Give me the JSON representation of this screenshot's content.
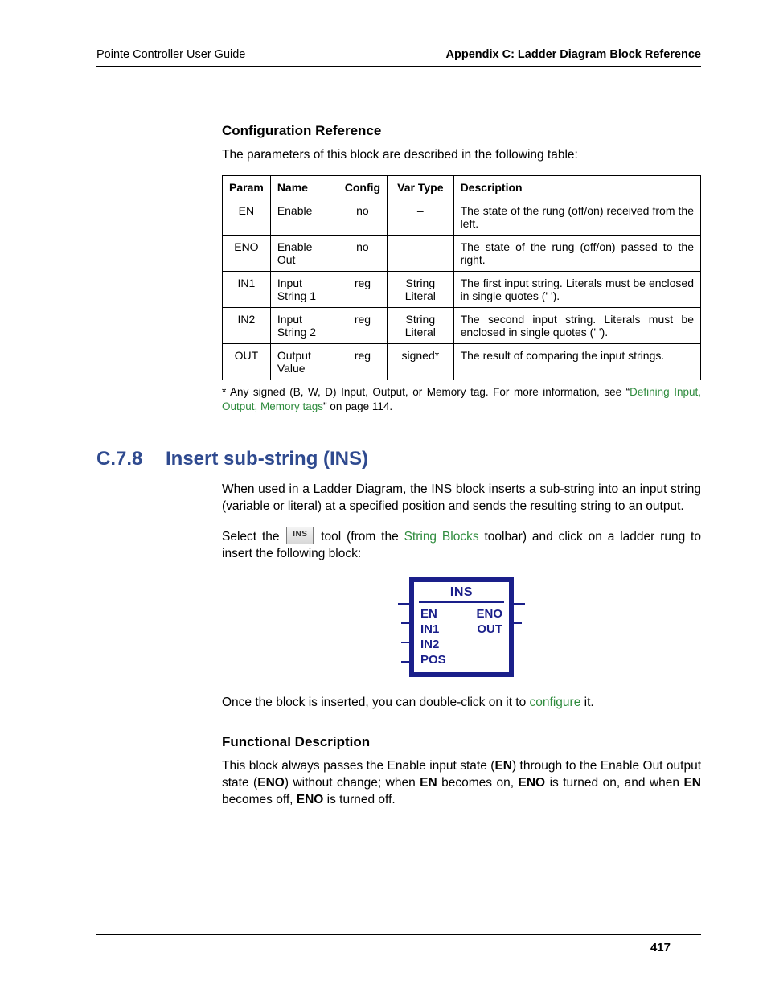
{
  "header": {
    "left": "Pointe Controller User Guide",
    "right": "Appendix C: Ladder Diagram Block Reference"
  },
  "config_ref": {
    "heading": "Configuration Reference",
    "intro": "The parameters of this block are described in the following table:",
    "columns": {
      "param": "Param",
      "name": "Name",
      "config": "Config",
      "vartype": "Var Type",
      "desc": "Description"
    },
    "rows": [
      {
        "param": "EN",
        "name": "Enable",
        "config": "no",
        "vartype": "–",
        "desc": "The state of the rung (off/on) received from the left."
      },
      {
        "param": "ENO",
        "name": "Enable Out",
        "config": "no",
        "vartype": "–",
        "desc": "The state of the rung (off/on) passed to the right."
      },
      {
        "param": "IN1",
        "name": "Input String 1",
        "config": "reg",
        "vartype": "String Literal",
        "desc": "The first input string. Literals must be enclosed in single quotes (' ')."
      },
      {
        "param": "IN2",
        "name": "Input String 2",
        "config": "reg",
        "vartype": "String Literal",
        "desc": "The second input string. Literals must be enclosed in single quotes (' ')."
      },
      {
        "param": "OUT",
        "name": "Output Value",
        "config": "reg",
        "vartype": "signed*",
        "desc": "The result of comparing the input strings."
      }
    ],
    "footnote_pre": "* Any signed (B, W, D) Input, Output, or Memory tag. For more information, see “",
    "footnote_link": "Defining Input, Output, Memory tags",
    "footnote_post": "” on page 114."
  },
  "section": {
    "num": "C.7.8",
    "title": "Insert sub-string (INS)",
    "para1": "When used in a Ladder Diagram, the INS block inserts a sub-string into an input string (variable or literal) at a specified position and sends the resulting string to an output.",
    "para2_pre": "Select the ",
    "para2_mid": " tool (from the ",
    "para2_link": "String Blocks",
    "para2_post": " toolbar) and click on a ladder rung to insert the following block:",
    "block": {
      "title": "INS",
      "left": [
        "EN",
        "IN1",
        "IN2",
        "POS"
      ],
      "right": [
        "ENO",
        "OUT",
        "",
        ""
      ]
    },
    "para3_pre": "Once the block is inserted, you can double-click on it to ",
    "para3_link": "configure",
    "para3_post": " it."
  },
  "funcdesc": {
    "heading": "Functional Description",
    "para_parts": [
      "This block always passes the Enable input state (",
      "EN",
      ") through to the Enable Out output state (",
      "ENO",
      ") without change; when ",
      "EN",
      " becomes on, ",
      "ENO",
      " is turned on, and when ",
      "EN",
      " becomes off, ",
      "ENO",
      " is turned off."
    ]
  },
  "page_number": "417"
}
